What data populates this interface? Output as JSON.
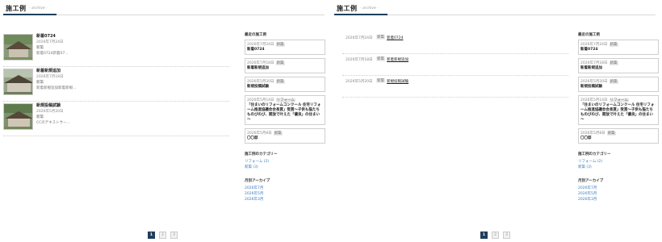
{
  "header": {
    "title": "施工例",
    "subtitle": "- archive -"
  },
  "left": {
    "posts": [
      {
        "title": "新着0724",
        "date": "2026年7月24日",
        "category": "新築",
        "excerpt": "新着0724新着07…"
      },
      {
        "title": "新着新規追加",
        "date": "2026年7月18日",
        "category": "新築",
        "excerpt": "新着新規追加新着新規…"
      },
      {
        "title": "新規投稿試験",
        "date": "2026年5月20日",
        "category": "新築",
        "excerpt": "CCのテキストサー…"
      }
    ]
  },
  "right": {
    "items": [
      {
        "date": "2026年7月24日",
        "category": "新築",
        "title": "新着0724"
      },
      {
        "date": "2026年7月18日",
        "category": "新築",
        "title": "新着新規追加"
      },
      {
        "date": "2026年5月20日",
        "category": "新築",
        "title": "新規投稿試験"
      }
    ]
  },
  "sidebar": {
    "recent_heading": "最近の施工例",
    "recent": [
      {
        "date": "2026年7月24日",
        "tag": "新築",
        "title": "新着0724"
      },
      {
        "date": "2026年7月18日",
        "tag": "新築",
        "title": "新着新規追加"
      },
      {
        "date": "2026年5月20日",
        "tag": "新築",
        "title": "新規投稿試験"
      },
      {
        "date": "2026年5月14日",
        "tag": "リフォーム",
        "title": "「住まいのリフォームコンクール 住宅リフォーム推進協議会会長賞」受賞～子供も猫たちものびのび、開放で叶えた「優良」の住まい～"
      },
      {
        "date": "2026年5月8日",
        "tag": "新築",
        "title": "〇〇邸"
      }
    ],
    "categories_heading": "施工例のカテゴリー",
    "categories": [
      "リフォーム (2)",
      "新築 (3)"
    ],
    "archive_heading": "月別アーカイブ",
    "archives": [
      "2026年7月",
      "2026年5月",
      "2026年3月"
    ]
  },
  "pagination": {
    "pages": [
      "1",
      "2",
      "3"
    ]
  },
  "colors": {
    "accent": "#1f3e5c",
    "link": "#3a7cc2"
  }
}
